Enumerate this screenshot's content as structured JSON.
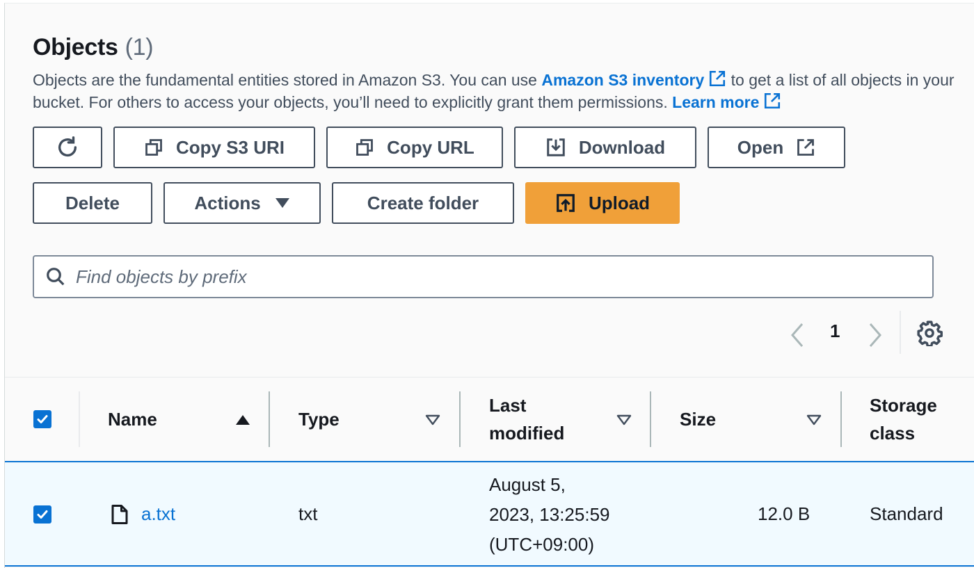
{
  "objects": {
    "title": "Objects",
    "count": "(1)",
    "description_part1": "Objects are the fundamental entities stored in Amazon S3. You can use ",
    "inventory_link": "Amazon S3 inventory",
    "description_part2": " to get a list of all objects in your bucket. For others to access your objects, you’ll need to explicitly grant them permissions. ",
    "learn_more": "Learn more"
  },
  "toolbar": {
    "copy_s3_uri": "Copy S3 URI",
    "copy_url": "Copy URL",
    "download": "Download",
    "open": "Open",
    "delete": "Delete",
    "actions": "Actions",
    "create_folder": "Create folder",
    "upload": "Upload"
  },
  "search": {
    "placeholder": "Find objects by prefix",
    "value": ""
  },
  "pagination": {
    "current_page": "1"
  },
  "table": {
    "columns": [
      "Name",
      "Type",
      "Last modified",
      "Size",
      "Storage class"
    ],
    "header_lines": {
      "last_modified": [
        "Last",
        "modified"
      ],
      "storage_class": [
        "Storage",
        "class"
      ]
    },
    "rows": [
      {
        "name": "a.txt",
        "type": "txt",
        "last_modified_lines": [
          "August 5,",
          "2023, 13:25:59",
          "(UTC+09:00)"
        ],
        "size": "12.0 B",
        "storage_class": "Standard",
        "selected": true
      }
    ]
  },
  "colors": {
    "accent": "#0972d3",
    "primary_button": "#f0a039",
    "selected_row": "#f1faff"
  },
  "icons": [
    "refresh-icon",
    "copy-icon",
    "download-icon",
    "external-link-icon",
    "caret-down-icon",
    "upload-icon",
    "search-icon",
    "chevron-left-icon",
    "chevron-right-icon",
    "gear-icon",
    "sort-ascending-icon",
    "sort-descending-icon",
    "file-icon",
    "checkbox-checked-icon"
  ]
}
